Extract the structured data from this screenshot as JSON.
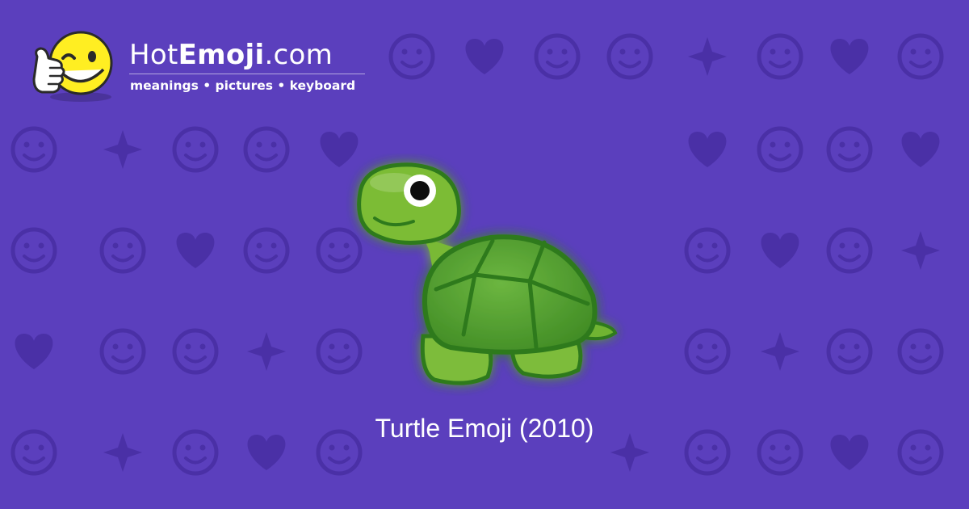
{
  "site": {
    "brand_prefix": "Hot",
    "brand_emphasis": "Emoji",
    "brand_suffix": ".com",
    "tagline": "meanings • pictures • keyboard"
  },
  "main": {
    "caption": "Turtle Emoji (2010)",
    "emoji_icon": "turtle-icon"
  },
  "background": {
    "icons": [
      "face-icon",
      "heart-icon",
      "sparkles-icon",
      "broken-heart-icon",
      "arrow-icon",
      "fire-icon",
      "rose-icon",
      "sun-icon",
      "check-icon",
      "camera-icon",
      "music-notes-icon",
      "recycle-icon"
    ]
  },
  "colors": {
    "background": "#5b3fbd",
    "pattern": "#4a30a6",
    "turtle_body": "#78b833",
    "turtle_shell": "#4f9a2c",
    "mascot_yellow": "#ffee22",
    "text": "#ffffff"
  }
}
